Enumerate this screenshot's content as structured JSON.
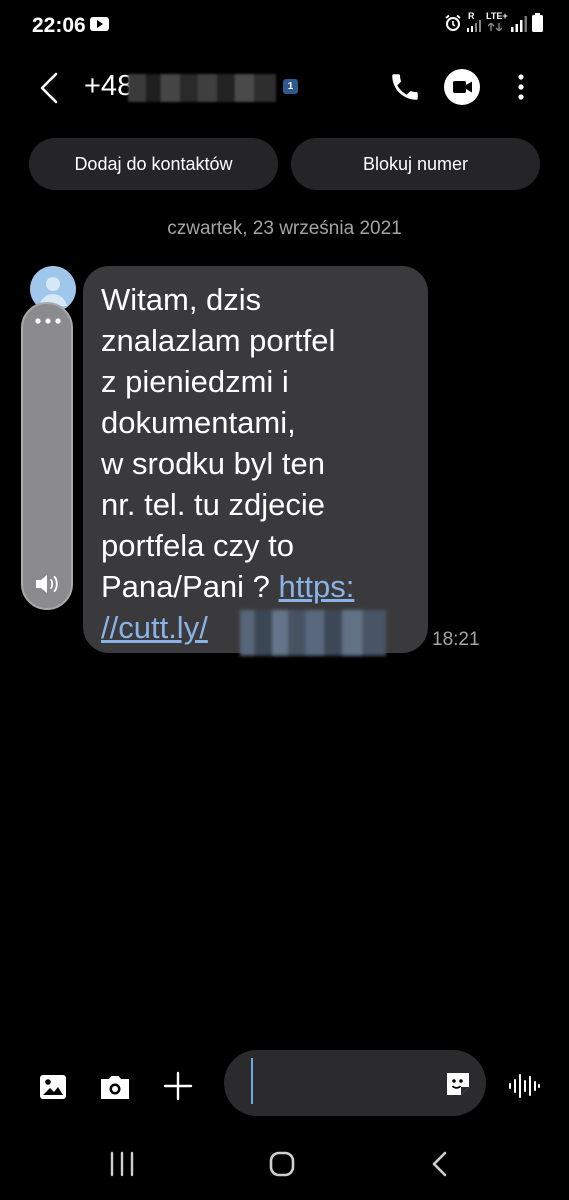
{
  "status_bar": {
    "time": "22:06",
    "network_label": "LTE+",
    "roaming_label": "R"
  },
  "header": {
    "phone_prefix": "+48",
    "sim_badge": "1"
  },
  "actions": {
    "add_contact_label": "Dodaj do kontaktów",
    "block_number_label": "Blokuj numer"
  },
  "conversation": {
    "date_separator": "czwartek, 23 września 2021",
    "message": {
      "text": "Witam, dzis\nznalazlam portfel\nz pieniedzmi i\ndokumentami,\nw srodku byl ten\nnr. tel. tu zdjecie\nportfela czy to\nPana/Pani ? ",
      "link_text": "https:\n//cutt.ly/",
      "time": "18:21"
    }
  },
  "colors": {
    "background": "#000000",
    "bubble": "#3a3a3c",
    "pill": "#252527",
    "link": "#8ab2e6",
    "muted_text": "#a4a4a4",
    "avatar": "#9fc7ec",
    "caret": "#6ea8e8"
  },
  "icons": {
    "back": "chevron-left-icon",
    "call": "phone-icon",
    "video": "video-camera-icon",
    "more": "more-vertical-icon",
    "gallery": "image-icon",
    "camera": "camera-icon",
    "attach": "plus-icon",
    "sticker": "sticker-icon",
    "voice": "voice-waveform-icon"
  }
}
